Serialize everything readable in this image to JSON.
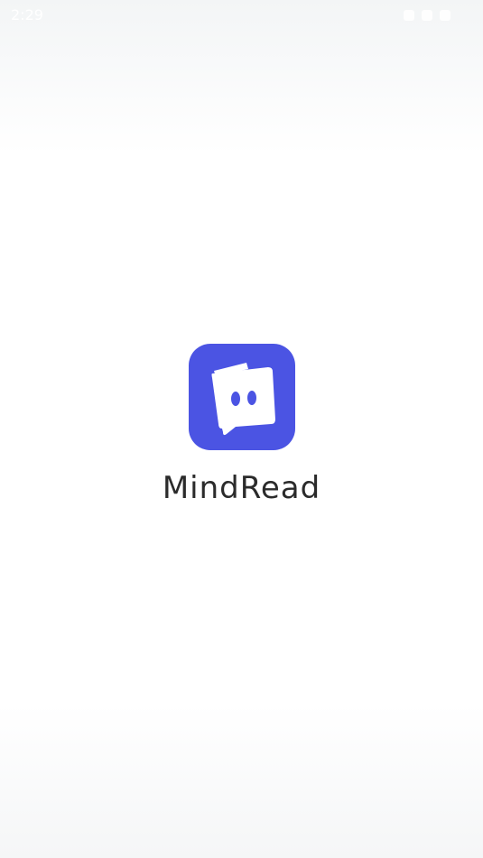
{
  "status_bar": {
    "time": "2:29"
  },
  "splash": {
    "app_icon": "chat-bubble-face-icon",
    "app_name": "MindRead"
  },
  "colors": {
    "brand": "#4b54e3",
    "text": "#2b2b2b"
  }
}
